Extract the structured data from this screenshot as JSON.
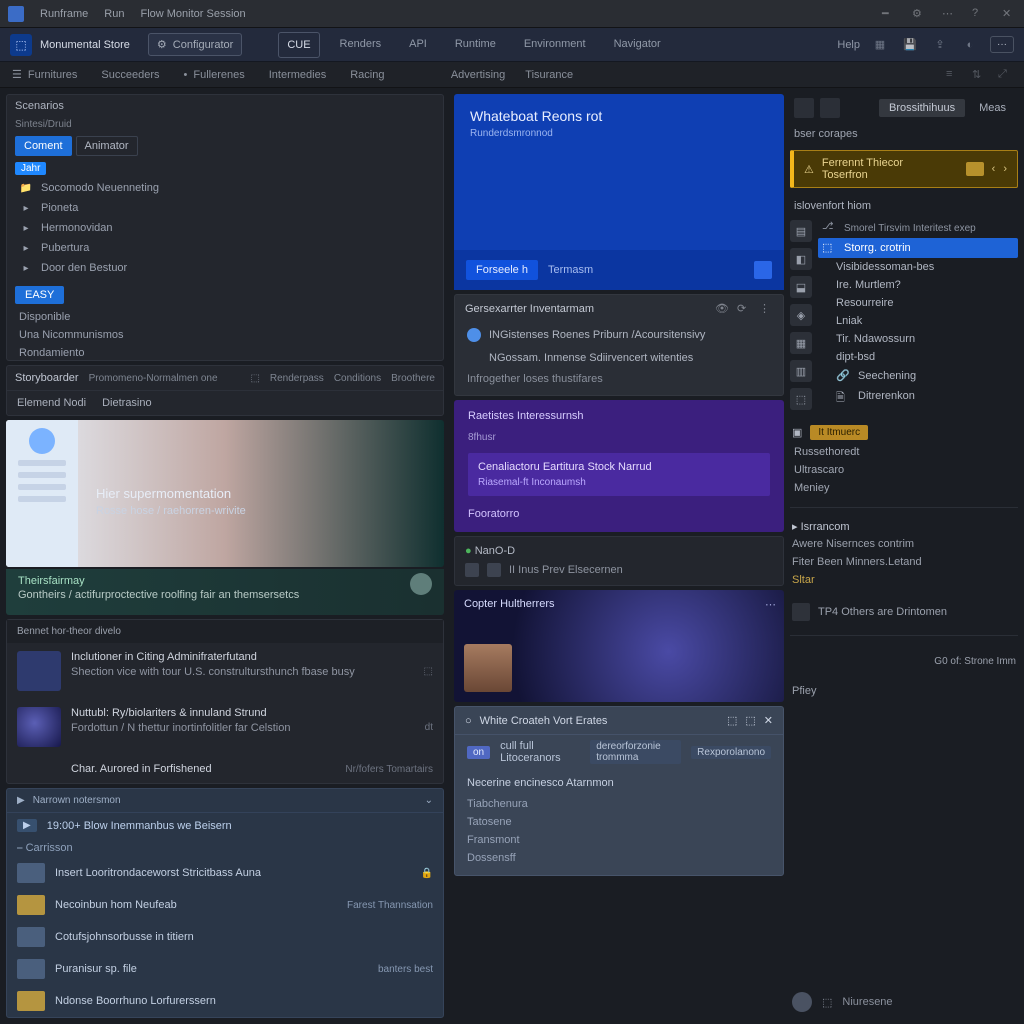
{
  "topbar": {
    "app": "Runframe",
    "menu1": "Run",
    "menu2": "Flow Monitor Session"
  },
  "appbar": {
    "brand": "Monumental Store",
    "configurator": "Configurator",
    "tabs": [
      "CUE",
      "Renders",
      "API",
      "Runtime",
      "Environment",
      "Navigator"
    ],
    "help": "Help",
    "more": "···"
  },
  "crumbs": {
    "items": [
      "Furnitures",
      "Succeeders",
      "Fullerenes",
      "Intermedies",
      "Racing"
    ],
    "center": [
      "Advertising",
      "Tisurance"
    ]
  },
  "a1": {
    "title": "Scenarios",
    "sub": "Sintesi/Druid",
    "chips": [
      "Coment",
      "Animator"
    ],
    "rows": [
      "Socomodo Neuenneting",
      "Pioneta",
      "Hermonovidan",
      "Pubertura",
      "Door den Bestuor"
    ],
    "badge_sel": "Jahr",
    "group": "EASY",
    "grouprows": [
      "Disponible",
      "Una Nicommunismos",
      "Rondamiento"
    ]
  },
  "a2": {
    "title": "Storyboarder",
    "subtitle": "Promomeno-Normalmen one",
    "k1": "Renderpass",
    "k2": "Conditions",
    "k3": "Broothere",
    "row1": "Elemend Nodi",
    "row2": "Dietrasino"
  },
  "hero": {
    "t1": "Hier supermomentation",
    "t2": "Rosse hose / raehorren-wrivite"
  },
  "green": {
    "t1": "Theirsfairmay",
    "t2": "Gontheirs / actifurproctective roolfing fair an themsersetcs"
  },
  "a3": {
    "h": "Bennet hor-theor divelo",
    "items": [
      {
        "l1": "Inclutioner in Citing Adminifraterfutand",
        "l2": "Shection vice with tour U.S. construltursthunch fbase busy"
      },
      {
        "l1": "Nuttubl: Ry/biolariters & innuland Strund",
        "l2": "Fordottun / N thettur inortinfolitler far Celstion",
        "tag": "dt"
      },
      {
        "l1": "Char. Aurored in Forfishened",
        "l2": "",
        "tag": "Nr/fofers Tomartairs"
      }
    ]
  },
  "a4": {
    "h": "Narrown notersmon",
    "sub": "19:00+ Blow Inemmanbus we Beisern",
    "cat": "Carrisson",
    "items": [
      {
        "t": "Insert Looritrondaceworst Stricitbass Auna"
      },
      {
        "t": "Necoinbun hom Neufeab",
        "rtag": "Farest Thannsation"
      },
      {
        "t": "Cotufsjohnsorbusse in titiern"
      },
      {
        "t": "Puranisur sp. file",
        "rtag": "banters best"
      },
      {
        "t": "Ndonse Boorrhuno Lorfurerssern"
      }
    ]
  },
  "b1": {
    "t": "Whateboat Reons rot",
    "s": "Runderdsmronnod",
    "btn": "Forseele h",
    "sec": "Termasm"
  },
  "b2": {
    "h": "Gersexarrter Inventarmam",
    "l1": "INGistenses Roenes Priburn /Acoursitensivy",
    "l2": "NGossam. Inmense Sdiirvencert witenties",
    "sub": "Infrogether loses thustifares"
  },
  "b3": {
    "t": "Raetistes Interessurnsh",
    "s": "8fhusr",
    "box_l1": "Cenaliactoru Eartitura Stock Narrud",
    "box_l2": "Riasemal-ft Inconaumsh",
    "link": "Fooratorro"
  },
  "b4": {
    "t": "NanO-D",
    "foot": "II Inus Prev Elsecernen"
  },
  "b5": {
    "t": "Copter Hultherrers"
  },
  "b6": {
    "h": "White Croateh Vort Erates",
    "sub1": "dereorforzonie trommma",
    "sub2": "Rexporolanono",
    "pill_l": "on",
    "pill_l2": "cull full Litoceranors",
    "hd": "Necerine encinesco Atarnmon",
    "rows": [
      "Tiabchenura",
      "Tatosene",
      "Fransmont",
      "Dossensff"
    ]
  },
  "c": {
    "btn1": "Brossithihuus",
    "btn2": "Meas",
    "sub": "bser corapes",
    "alert": "Ferrennt Thiecor Toserfron",
    "subh": "islovenfort hiom",
    "tree_top": "Smorel Tirsvim Interitest exep",
    "tree_sel": "Storrg. crotrin",
    "tree_items": [
      "Visibidessoman-bes",
      "Ire. Murtlem?",
      "Resourreire",
      "Lniak",
      "Tir. Ndawossurn",
      "dipt-bsd",
      "Seechening",
      "Ditrerenkon"
    ],
    "gold": "It Itmuerc",
    "panel2": [
      "Russethoredt",
      "Ultrascaro",
      "Meniey"
    ],
    "steps_title": "Isrrancom",
    "steps": [
      "Awere Nisernces contrim",
      "Fiter Been Minners.Letand"
    ],
    "steps_badge": "Sltar",
    "foot_item": "TP4 Others are Drintomen",
    "foot2_l": "G0 of: Strone Imm",
    "foot2_b": "Pfiey",
    "lastrow": "Niuresene"
  }
}
